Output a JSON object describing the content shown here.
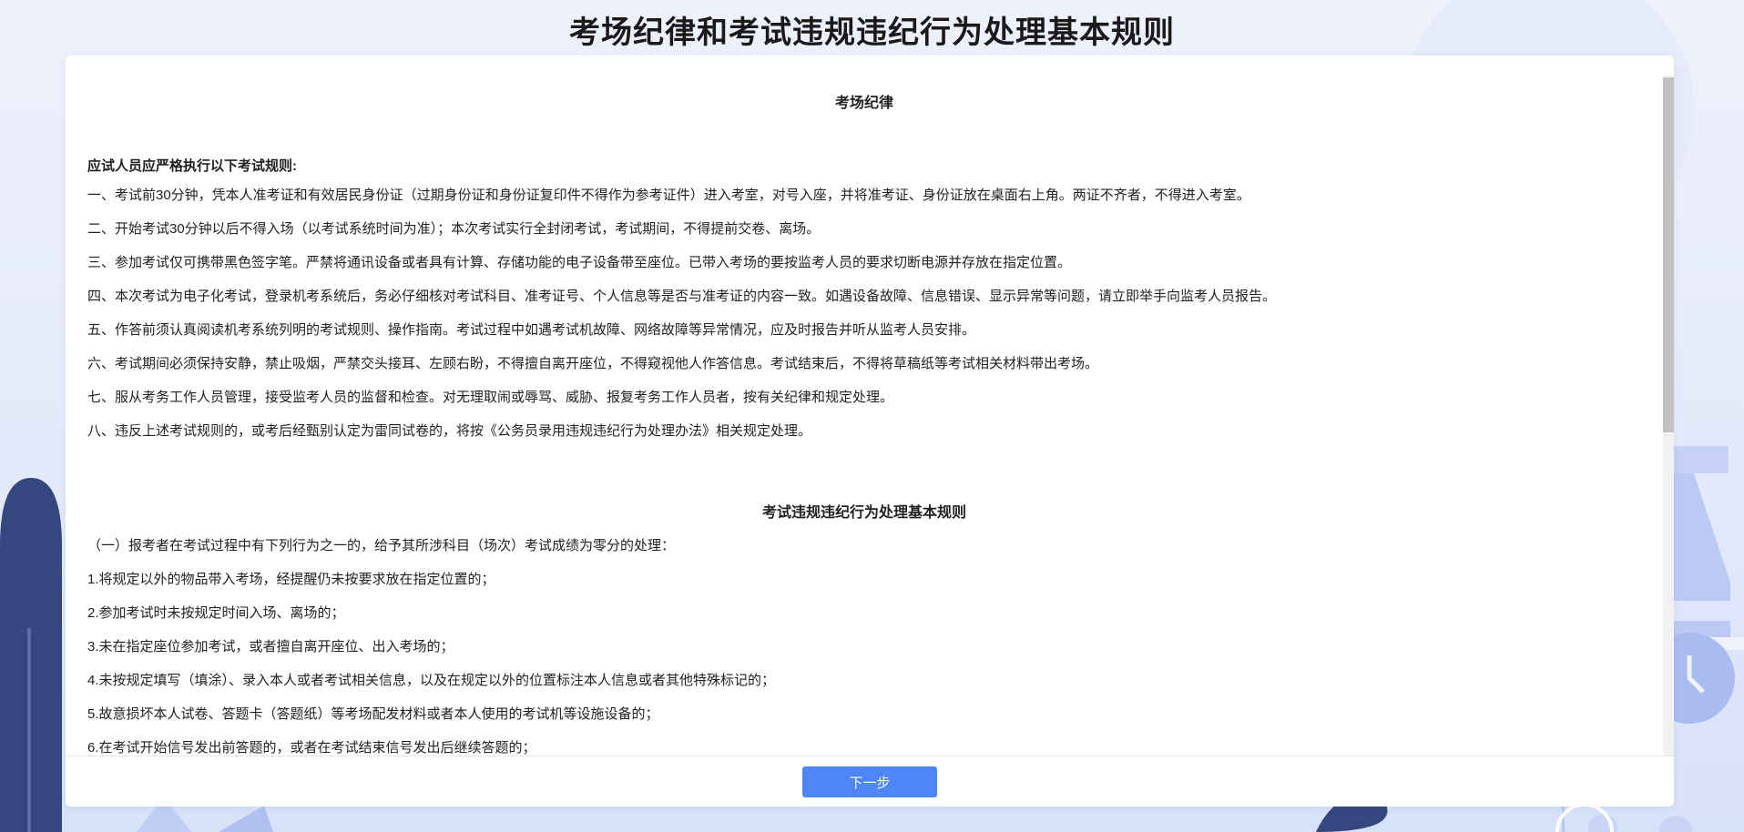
{
  "page": {
    "title": "考场纪律和考试违规违纪行为处理基本规则"
  },
  "discipline": {
    "heading": "考场纪律",
    "intro": "应试人员应严格执行以下考试规则:",
    "rules": [
      "一、考试前30分钟，凭本人准考证和有效居民身份证（过期身份证和身份证复印件不得作为参考证件）进入考室，对号入座，并将准考证、身份证放在桌面右上角。两证不齐者，不得进入考室。",
      "二、开始考试30分钟以后不得入场（以考试系统时间为准）；本次考试实行全封闭考试，考试期间，不得提前交卷、离场。",
      "三、参加考试仅可携带黑色签字笔。严禁将通讯设备或者具有计算、存储功能的电子设备带至座位。已带入考场的要按监考人员的要求切断电源并存放在指定位置。",
      "四、本次考试为电子化考试，登录机考系统后，务必仔细核对考试科目、准考证号、个人信息等是否与准考证的内容一致。如遇设备故障、信息错误、显示异常等问题，请立即举手向监考人员报告。",
      "五、作答前须认真阅读机考系统列明的考试规则、操作指南。考试过程中如遇考试机故障、网络故障等异常情况，应及时报告并听从监考人员安排。",
      "六、考试期间必须保持安静，禁止吸烟，严禁交头接耳、左顾右盼，不得擅自离开座位，不得窥视他人作答信息。考试结束后，不得将草稿纸等考试相关材料带出考场。",
      "七、服从考务工作人员管理，接受监考人员的监督和检查。对无理取闹或辱骂、威胁、报复考务工作人员者，按有关纪律和规定处理。",
      "八、违反上述考试规则的，或考后经甄别认定为雷同试卷的，将按《公务员录用违规违纪行为处理办法》相关规定处理。"
    ]
  },
  "violations": {
    "heading": "考试违规违纪行为处理基本规则",
    "intro": "（一）报考者在考试过程中有下列行为之一的，给予其所涉科目（场次）考试成绩为零分的处理：",
    "items": [
      "1.将规定以外的物品带入考场，经提醒仍未按要求放在指定位置的；",
      "2.参加考试时未按规定时间入场、离场的；",
      "3.未在指定座位参加考试，或者擅自离开座位、出入考场的；",
      "4.未按规定填写（填涂）、录入本人或者考试相关信息，以及在规定以外的位置标注本人信息或者其他特殊标记的；",
      "5.故意损坏本人试卷、答题卡（答题纸）等考场配发材料或者本人使用的考试机等设施设备的；",
      "6.在考试开始信号发出前答题的，或者在考试结束信号发出后继续答题的；"
    ]
  },
  "footer": {
    "next_label": "下一步"
  },
  "colors": {
    "accent": "#4f86f7",
    "decor_dark": "#34477e",
    "decor_light": "#a9bcf0"
  }
}
